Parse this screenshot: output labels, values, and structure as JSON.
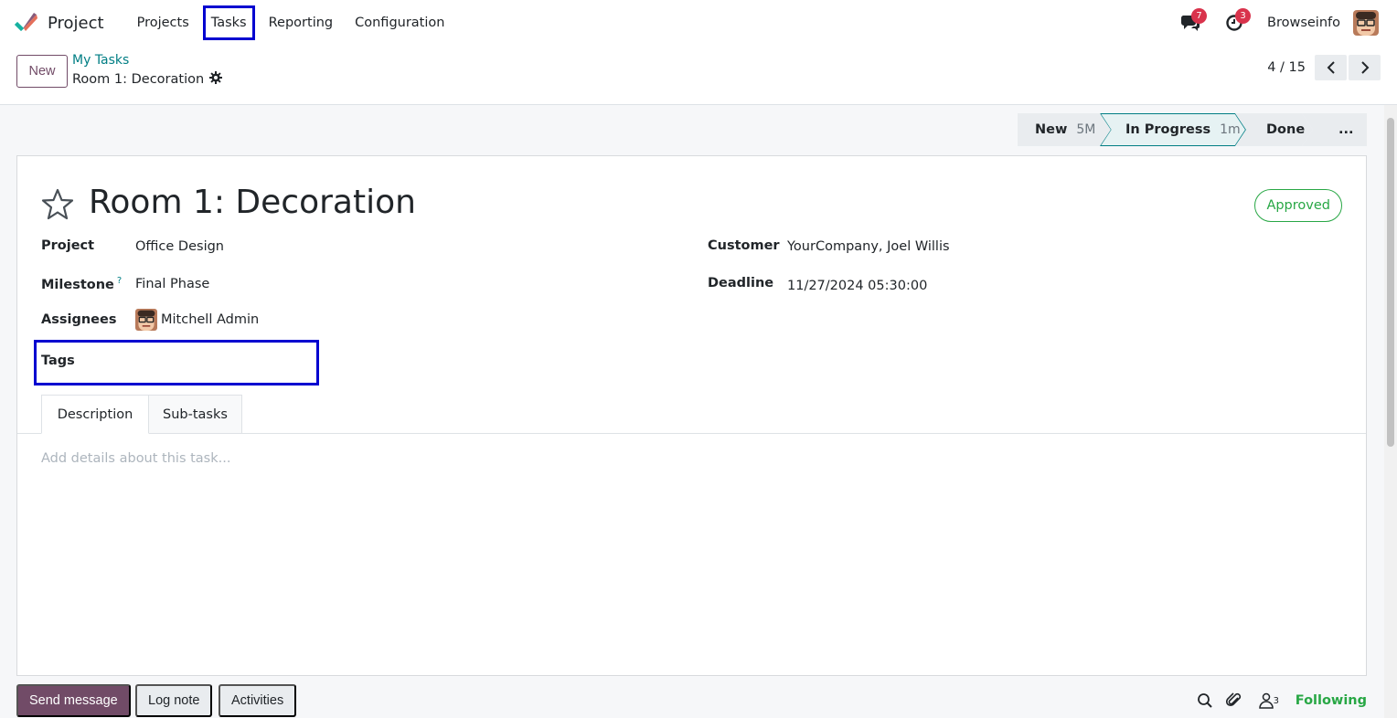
{
  "topnav": {
    "app_title": "Project",
    "menu": [
      "Projects",
      "Tasks",
      "Reporting",
      "Configuration"
    ],
    "messages_badge": "7",
    "activities_badge": "3",
    "company": "Browseinfo"
  },
  "control_panel": {
    "new_label": "New",
    "breadcrumb_parent": "My Tasks",
    "breadcrumb_current": "Room 1: Decoration",
    "pager_value": "4 / 15"
  },
  "statusbar": {
    "stages": [
      {
        "label": "New",
        "time": "5M"
      },
      {
        "label": "In Progress",
        "time": "1m"
      },
      {
        "label": "Done",
        "time": ""
      },
      {
        "label": "...",
        "time": ""
      }
    ],
    "active_stage": "In Progress"
  },
  "form": {
    "title": "Room 1: Decoration",
    "status_badge": "Approved",
    "fields": {
      "project_label": "Project",
      "project_value": "Office Design",
      "milestone_label": "Milestone",
      "milestone_help": "?",
      "milestone_value": "Final Phase",
      "assignees_label": "Assignees",
      "assignees_value": "Mitchell Admin",
      "tags_label": "Tags",
      "customer_label": "Customer",
      "customer_value": "YourCompany, Joel Willis",
      "deadline_label": "Deadline",
      "deadline_value": "11/27/2024 05:30:00"
    },
    "tabs": [
      "Description",
      "Sub-tasks"
    ],
    "description_placeholder": "Add details about this task..."
  },
  "chatter": {
    "send_message": "Send message",
    "log_note": "Log note",
    "activities": "Activities",
    "followers_count": "3",
    "following": "Following"
  },
  "colors": {
    "brand": "#714b67",
    "link": "#017e84",
    "success": "#28a745",
    "badge": "#d9334c",
    "highlight_box": "#0000d0"
  }
}
